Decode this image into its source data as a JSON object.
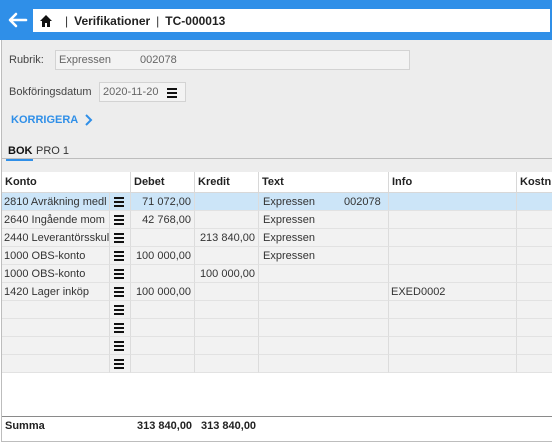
{
  "header": {
    "section": "Verifikationer",
    "record_id": "TC-000013"
  },
  "form": {
    "rubrik_label": "Rubrik:",
    "rubrik_value": "Expressen",
    "rubrik_ref": "002078",
    "date_label": "Bokföringsdatum",
    "date_value": "2020-11-20",
    "korrigera": "KORRIGERA"
  },
  "tabs": [
    {
      "label": "BOK",
      "active": true
    },
    {
      "label": "PRO 1",
      "active": false
    }
  ],
  "table": {
    "columns": [
      "Konto",
      "Debet",
      "Kredit",
      "Text",
      "Info",
      "Kostn"
    ],
    "rows": [
      {
        "konto": "2810 Avräkning medl",
        "debet": "71 072,00",
        "kredit": "",
        "text": "Expressen",
        "text_ref": "002078",
        "info": "",
        "selected": true
      },
      {
        "konto": "2640 Ingående mom",
        "debet": "42 768,00",
        "kredit": "",
        "text": "Expressen",
        "text_ref": "",
        "info": "",
        "selected": false
      },
      {
        "konto": "2440 Leverantörsskul",
        "debet": "",
        "kredit": "213 840,00",
        "text": "Expressen",
        "text_ref": "",
        "info": "",
        "selected": false
      },
      {
        "konto": "1000 OBS-konto",
        "debet": "100 000,00",
        "kredit": "",
        "text": "Expressen",
        "text_ref": "",
        "info": "",
        "selected": false
      },
      {
        "konto": "1000 OBS-konto",
        "debet": "",
        "kredit": "100 000,00",
        "text": "",
        "text_ref": "",
        "info": "",
        "selected": false
      },
      {
        "konto": "1420 Lager inköp",
        "debet": "100 000,00",
        "kredit": "",
        "text": "",
        "text_ref": "",
        "info": "EXED0002",
        "selected": false
      },
      {
        "konto": "",
        "debet": "",
        "kredit": "",
        "text": "",
        "text_ref": "",
        "info": "",
        "selected": false
      },
      {
        "konto": "",
        "debet": "",
        "kredit": "",
        "text": "",
        "text_ref": "",
        "info": "",
        "selected": false
      },
      {
        "konto": "",
        "debet": "",
        "kredit": "",
        "text": "",
        "text_ref": "",
        "info": "",
        "selected": false
      },
      {
        "konto": "",
        "debet": "",
        "kredit": "",
        "text": "",
        "text_ref": "",
        "info": "",
        "selected": false
      }
    ]
  },
  "summary": {
    "label": "Summa",
    "debet": "313 840,00",
    "kredit": "313 840,00"
  },
  "colors": {
    "accent": "#2f8fe8",
    "selected_row": "#cce5f8"
  }
}
